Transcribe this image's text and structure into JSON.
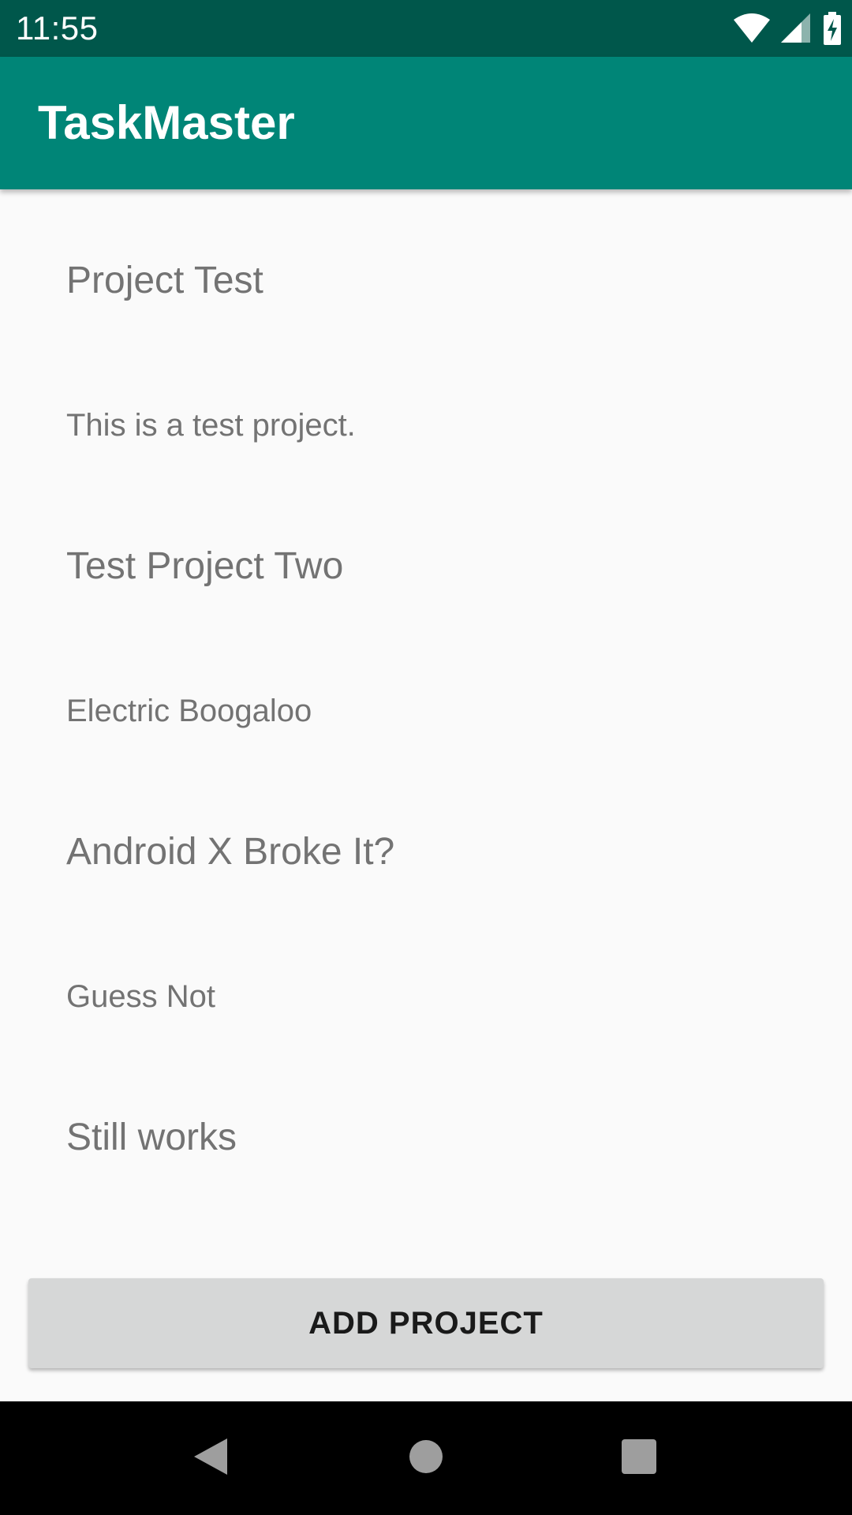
{
  "status_bar": {
    "time": "11:55",
    "icons": [
      "wifi-icon",
      "signal-icon",
      "battery-charging-icon"
    ]
  },
  "app_bar": {
    "title": "TaskMaster"
  },
  "projects": [
    {
      "name": "Project Test",
      "description": "This is a test project."
    },
    {
      "name": "Test Project Two",
      "description": "Electric Boogaloo"
    },
    {
      "name": "Android X Broke It?",
      "description": "Guess Not"
    },
    {
      "name": "Still works",
      "description": ""
    }
  ],
  "add_button": {
    "label": "ADD PROJECT"
  },
  "nav_bar": {
    "icons": [
      "back-icon",
      "home-icon",
      "recents-icon"
    ]
  },
  "colors": {
    "status_bar": "#00574b",
    "app_bar": "#008577",
    "background": "#fafafa",
    "button": "#d6d7d7",
    "text_secondary": "#737373"
  }
}
